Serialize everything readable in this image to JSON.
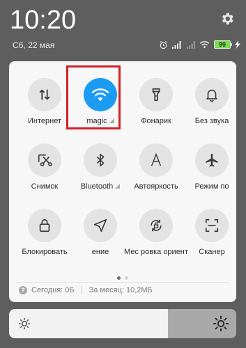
{
  "status": {
    "time": "10:20",
    "date": "Сб, 22 мая",
    "battery": "99"
  },
  "tiles": [
    {
      "name": "tile-internet",
      "label": "Интернет",
      "icon": "mobile-data-icon",
      "active": false,
      "signal": false
    },
    {
      "name": "tile-wifi",
      "label": "magic",
      "icon": "wifi-icon",
      "active": true,
      "signal": true
    },
    {
      "name": "tile-flashlight",
      "label": "Фонарик",
      "icon": "flashlight-icon",
      "active": false,
      "signal": false
    },
    {
      "name": "tile-silent",
      "label": "Без звука",
      "icon": "bell-icon",
      "active": false,
      "signal": false
    },
    {
      "name": "tile-screenshot",
      "label": "Снимок",
      "icon": "scissors-icon",
      "active": false,
      "signal": false
    },
    {
      "name": "tile-bluetooth",
      "label": "Bluetooth",
      "icon": "bluetooth-icon",
      "active": false,
      "signal": true
    },
    {
      "name": "tile-auto-brightness",
      "label": "Автояркость",
      "icon": "auto-brightness-icon",
      "active": false,
      "signal": false
    },
    {
      "name": "tile-airplane",
      "label": "Режим по",
      "icon": "airplane-icon",
      "active": false,
      "signal": false
    },
    {
      "name": "tile-lock",
      "label": "Блокировать",
      "icon": "lock-icon",
      "active": false,
      "signal": false
    },
    {
      "name": "tile-location",
      "label": "ение",
      "icon": "location-icon",
      "active": false,
      "signal": false
    },
    {
      "name": "tile-rotation-lock",
      "label": "Мес ровка ориент",
      "icon": "rotation-lock-icon",
      "active": false,
      "signal": false
    },
    {
      "name": "tile-scanner",
      "label": "Сканер",
      "icon": "scanner-icon",
      "active": false,
      "signal": false
    }
  ],
  "page_dots": {
    "count": 2,
    "active": 0
  },
  "usage": {
    "info_glyph": "?",
    "today": "Сегодня: 0Б",
    "month": "За месяц: 10,2МБ"
  },
  "brightness": {
    "level": 0.7
  },
  "colors": {
    "accent": "#1c9bf3",
    "highlight": "#d22027",
    "battery": "#7ed957"
  }
}
